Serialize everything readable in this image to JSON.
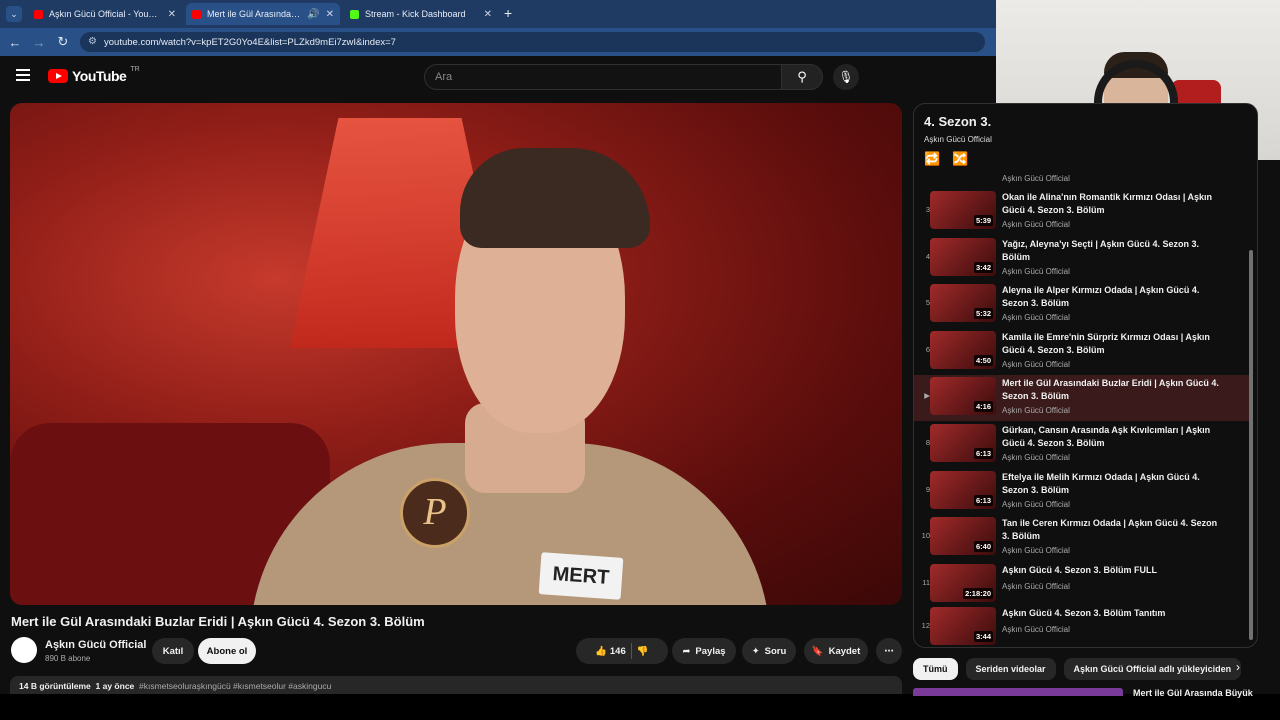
{
  "browser": {
    "tabs": [
      {
        "title": "Aşkın Gücü Official - YouTube",
        "favicon_color": "#ff0000",
        "active": false
      },
      {
        "title": "Mert ile Gül Arasındaki Buzl",
        "favicon_color": "#ff0000",
        "active": true
      },
      {
        "title": "Stream - Kick Dashboard",
        "favicon_color": "#53fc18",
        "active": false
      }
    ],
    "url": "youtube.com/watch?v=kpET2G0Yo4E&list=PLZkd9mEi7zwI&index=7"
  },
  "header": {
    "logo_text": "YouTube",
    "country": "TR",
    "search_placeholder": "Ara"
  },
  "video": {
    "overlay_nametag": "MERT",
    "badge_letter": "P",
    "title": "Mert ile Gül Arasındaki Buzlar Eridi | Aşkın Gücü 4. Sezon 3. Bölüm",
    "channel": "Aşkın Gücü Official",
    "subscribers": "890 B abone",
    "join_label": "Katıl",
    "subscribe_label": "Abone ol",
    "likes": "146",
    "share_label": "Paylaş",
    "ask_label": "Soru",
    "save_label": "Kaydet",
    "views": "14 B görüntüleme",
    "age": "1 ay önce",
    "hashtags": "#kısmetseoluraşkıngücü #kısmetseolur #askingucu"
  },
  "playlist": {
    "title": "4. Sezon 3.",
    "owner": "Aşkın Gücü Official",
    "partial_top_channel": "Aşkın Gücü Official",
    "items": [
      {
        "num": "3",
        "title": "Okan ile Alina'nın Romantik Kırmızı Odası | Aşkın Gücü 4. Sezon 3. Bölüm",
        "duration": "5:39",
        "channel": "Aşkın Gücü Official",
        "active": false
      },
      {
        "num": "4",
        "title": "Yağız, Aleyna'yı Seçti | Aşkın Gücü 4. Sezon 3. Bölüm",
        "duration": "3:42",
        "channel": "Aşkın Gücü Official",
        "active": false
      },
      {
        "num": "5",
        "title": "Aleyna ile Alper Kırmızı Odada | Aşkın Gücü 4. Sezon 3. Bölüm",
        "duration": "5:32",
        "channel": "Aşkın Gücü Official",
        "active": false
      },
      {
        "num": "6",
        "title": "Kamila ile Emre'nin Sürpriz Kırmızı Odası | Aşkın Gücü 4. Sezon 3. Bölüm",
        "duration": "4:50",
        "channel": "Aşkın Gücü Official",
        "active": false
      },
      {
        "num": "▶",
        "title": "Mert ile Gül Arasındaki Buzlar Eridi | Aşkın Gücü 4. Sezon 3. Bölüm",
        "duration": "4:16",
        "channel": "Aşkın Gücü Official",
        "active": true
      },
      {
        "num": "8",
        "title": "Gürkan, Cansın Arasında Aşk Kıvılcımları | Aşkın Gücü 4. Sezon 3. Bölüm",
        "duration": "6:13",
        "channel": "Aşkın Gücü Official",
        "active": false
      },
      {
        "num": "9",
        "title": "Eftelya ile Melih Kırmızı Odada | Aşkın Gücü 4. Sezon 3. Bölüm",
        "duration": "6:13",
        "channel": "Aşkın Gücü Official",
        "active": false
      },
      {
        "num": "10",
        "title": "Tan ile Ceren Kırmızı Odada | Aşkın Gücü 4. Sezon 3. Bölüm",
        "duration": "6:40",
        "channel": "Aşkın Gücü Official",
        "active": false
      },
      {
        "num": "11",
        "title": "Aşkın Gücü 4. Sezon 3. Bölüm FULL",
        "duration": "2:18:20",
        "channel": "Aşkın Gücü Official",
        "active": false
      },
      {
        "num": "12",
        "title": "Aşkın Gücü 4. Sezon 3. Bölüm Tanıtım",
        "duration": "3:44",
        "channel": "Aşkın Gücü Official",
        "active": false
      }
    ]
  },
  "chips": [
    "Tümü",
    "Seriden videolar",
    "Aşkın Gücü Official adlı yükleyiciden"
  ],
  "recommendation_peek_title": "Mert ile Gül Arasında Büyük",
  "colors": {
    "accent": "#ff0000",
    "background": "#0f0f0f",
    "active_row": "#3a1a1a"
  }
}
